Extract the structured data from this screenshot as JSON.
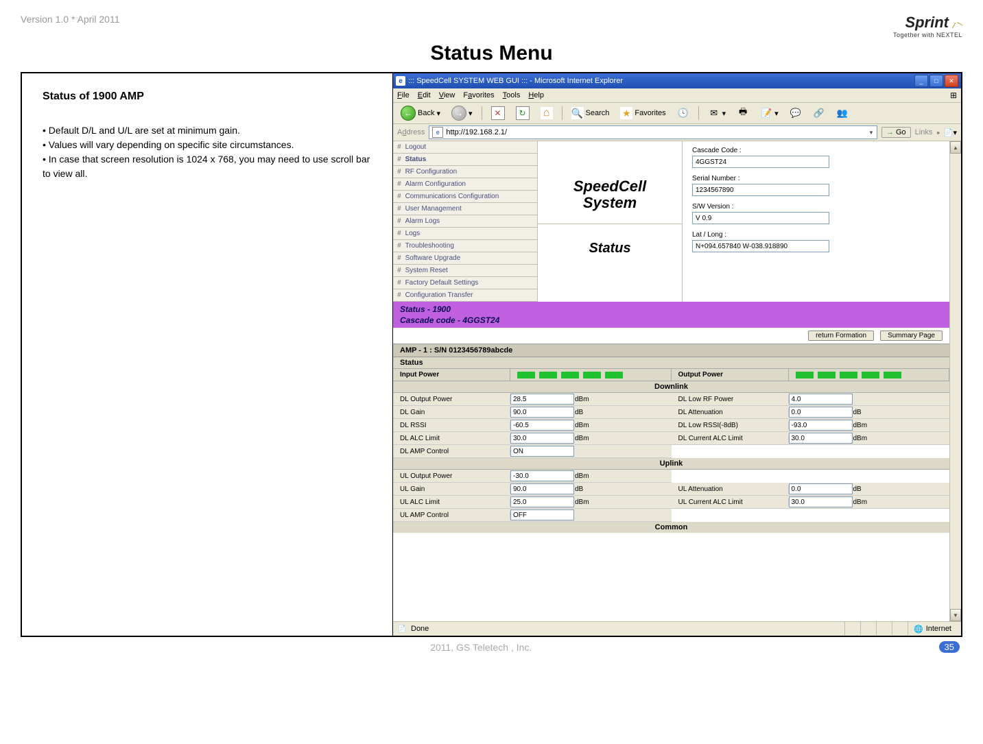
{
  "doc": {
    "version": "Version 1.0 * April 2011",
    "brand": "Sprint",
    "tagline": "Together with NEXTEL",
    "title": "Status Menu",
    "footer": "2011, GS Teletech , Inc.",
    "page_num": "35",
    "section_head": "Status of 1900 AMP",
    "bullet1": "•   Default D/L and U/L are set at minimum gain.",
    "bullet2": "• Values will vary depending on specific site circumstances.",
    "bullet3": "•  In case that screen resolution is 1024 x 768, you may need to use scroll bar to view all."
  },
  "ie": {
    "title": "::: SpeedCell SYSTEM WEB GUI ::: - Microsoft Internet Explorer",
    "menus": [
      "File",
      "Edit",
      "View",
      "Favorites",
      "Tools",
      "Help"
    ],
    "back": "Back",
    "search": "Search",
    "favorites": "Favorites",
    "address_label": "Address",
    "url": "http://192.168.2.1/",
    "go": "Go",
    "links": "Links",
    "status_done": "Done",
    "status_zone": "Internet"
  },
  "nav": {
    "items": [
      "Logout",
      "Status",
      "RF Configuration",
      "Alarm Configuration",
      "Communications Configuration",
      "User Management",
      "Alarm Logs",
      "Logs",
      "Troubleshooting",
      "Software Upgrade",
      "System Reset",
      "Factory Default Settings",
      "Configuration Transfer"
    ]
  },
  "brand_panel": {
    "product": "SpeedCell System",
    "page": "Status"
  },
  "info": {
    "cascade_label": "Cascade Code :",
    "cascade_value": "4GGST24",
    "serial_label": "Serial Number :",
    "serial_value": "1234567890",
    "sw_label": "S/W Version :",
    "sw_value": "V 0.9",
    "latlong_label": "Lat / Long :",
    "latlong_value": "N+094.657840 W-038.918890"
  },
  "purple": {
    "line1": "Status - 1900",
    "line2": "Cascade code - 4GGST24"
  },
  "buttons": {
    "return": "return Formation",
    "summary": "Summary Page"
  },
  "amp": {
    "header": "AMP - 1 : S/N 0123456789abcde",
    "status": "Status",
    "input_power": "Input Power",
    "output_power": "Output Power",
    "downlink": "Downlink",
    "uplink": "Uplink",
    "common": "Common"
  },
  "dl": {
    "rows_left": [
      {
        "label": "DL Output Power",
        "value": "28.5",
        "unit": "dBm"
      },
      {
        "label": "DL Gain",
        "value": "90.0",
        "unit": "dB"
      },
      {
        "label": "DL RSSI",
        "value": "-60.5",
        "unit": "dBm"
      },
      {
        "label": "DL ALC Limit",
        "value": "30.0",
        "unit": "dBm"
      },
      {
        "label": "DL AMP Control",
        "value": "ON",
        "unit": ""
      }
    ],
    "rows_right": [
      {
        "label": "DL Low RF Power",
        "value": "4.0",
        "unit": ""
      },
      {
        "label": "DL Attenuation",
        "value": "0.0",
        "unit": "dB"
      },
      {
        "label": "DL Low RSSI(-8dB)",
        "value": "-93.0",
        "unit": "dBm"
      },
      {
        "label": "DL Current ALC Limit",
        "value": "30.0",
        "unit": "dBm"
      }
    ]
  },
  "ul": {
    "rows_left": [
      {
        "label": "UL Output Power",
        "value": "-30.0",
        "unit": "dBm"
      },
      {
        "label": "UL Gain",
        "value": "90.0",
        "unit": "dB"
      },
      {
        "label": "UL ALC Limit",
        "value": "25.0",
        "unit": "dBm"
      },
      {
        "label": "UL AMP Control",
        "value": "OFF",
        "unit": ""
      }
    ],
    "rows_right": [
      {
        "label": "",
        "value": "",
        "unit": ""
      },
      {
        "label": "UL Attenuation",
        "value": "0.0",
        "unit": "dB"
      },
      {
        "label": "UL Current ALC Limit",
        "value": "30.0",
        "unit": "dBm"
      }
    ]
  }
}
